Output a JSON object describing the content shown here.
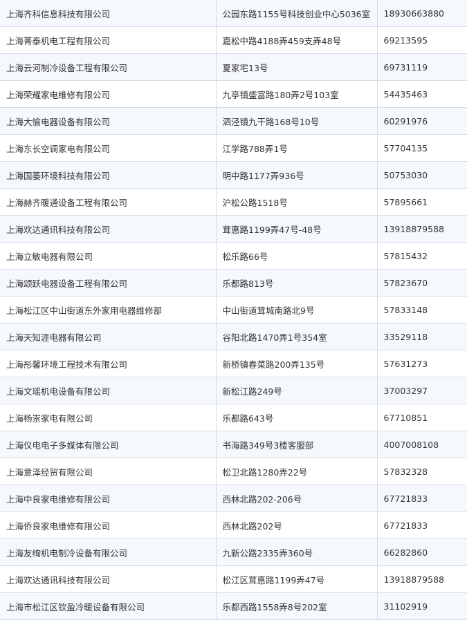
{
  "table": {
    "rows": [
      {
        "company": "上海齐科信息科技有限公司",
        "address": "公园东路1155号科技创业中心5036室",
        "phone": "18930663880"
      },
      {
        "company": "上海菁泰机电工程有限公司",
        "address": "嘉松中路4188弄459支弄48号",
        "phone": "69213595"
      },
      {
        "company": "上海云河制冷设备工程有限公司",
        "address": "夏家宅13号",
        "phone": "69731119"
      },
      {
        "company": "上海荣耀家电维修有限公司",
        "address": "九亭镇盛富路180弄2号103室",
        "phone": "54435463"
      },
      {
        "company": "上海大愉电器设备有限公司",
        "address": "泗泾镇九干路168号10号",
        "phone": "60291976"
      },
      {
        "company": "上海东长空调家电有限公司",
        "address": "江学路788弄1号",
        "phone": "57704135"
      },
      {
        "company": "上海国萎环境科技有限公司",
        "address": "明中路1177弄936号",
        "phone": "50753030"
      },
      {
        "company": "上海赫齐暖通设备工程有限公司",
        "address": "沪松公路1518号",
        "phone": "57895661"
      },
      {
        "company": "上海欢达通讯科技有限公司",
        "address": "茸悳路1199弄47号-48号",
        "phone": "13918879588"
      },
      {
        "company": "上海立敏电器有限公司",
        "address": "松乐路66号",
        "phone": "57815432"
      },
      {
        "company": "上海颂跃电器设备工程有限公司",
        "address": "乐都路813号",
        "phone": "57823670"
      },
      {
        "company": "上海松江区中山街道东外家用电器维修部",
        "address": "中山街道茸城南路北9号",
        "phone": "57833148"
      },
      {
        "company": "上海天知涯电器有限公司",
        "address": "谷阳北路1470弄1号354室",
        "phone": "33529118"
      },
      {
        "company": "上海彤馨环境工程技术有限公司",
        "address": "新桥镇春菜路200弄135号",
        "phone": "57631273"
      },
      {
        "company": "上海文瑶机电设备有限公司",
        "address": "新松江路249号",
        "phone": "37003297"
      },
      {
        "company": "上海杨崇家电有限公司",
        "address": "乐都路643号",
        "phone": "67710851"
      },
      {
        "company": "上海仪电电子多媒体有限公司",
        "address": "书海路349号3楼客服部",
        "phone": "4007008108"
      },
      {
        "company": "上海意泽经贸有限公司",
        "address": "松卫北路1280弄22号",
        "phone": "57832328"
      },
      {
        "company": "上海中良家电维修有限公司",
        "address": "西林北路202-206号",
        "phone": "67721833"
      },
      {
        "company": "上海侨良家电维修有限公司",
        "address": "西林北路202号",
        "phone": "67721833"
      },
      {
        "company": "上海友绚机电制冷设备有限公司",
        "address": "九新公路2335弄360号",
        "phone": "66282860"
      },
      {
        "company": "上海欢达通讯科技有限公司",
        "address": "松江区茸悳路1199弄47号",
        "phone": "13918879588"
      },
      {
        "company": "上海市松江区钦盈冷暖设备有限公司",
        "address": "乐都西路1558弄8号202室",
        "phone": "31102919"
      }
    ]
  }
}
